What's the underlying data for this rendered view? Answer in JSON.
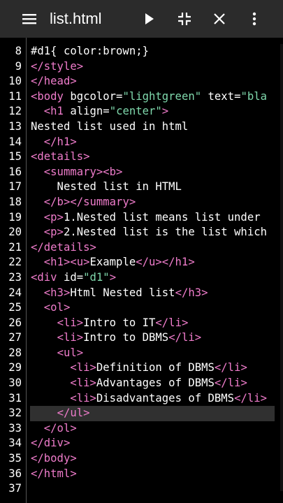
{
  "toolbar": {
    "title": "list.html",
    "icons": [
      "menu-icon",
      "play-icon",
      "collapse-icon",
      "close-icon",
      "more-vert-icon"
    ]
  },
  "colors": {
    "tag": "#ef7ccb",
    "string": "#7fd8ac",
    "text": "#ffffff",
    "background": "#000000",
    "toolbar": "#2b2b2b"
  },
  "editor": {
    "current_line": 32,
    "lines": [
      {
        "n": "8",
        "segs": [
          {
            "c": "a",
            "t": "#d1{ color:brown;}"
          }
        ]
      },
      {
        "n": "9",
        "segs": [
          {
            "c": "t",
            "t": "</style>"
          }
        ]
      },
      {
        "n": "10",
        "segs": [
          {
            "c": "t",
            "t": "</head>"
          }
        ]
      },
      {
        "n": "11",
        "segs": [
          {
            "c": "t",
            "t": "<body "
          },
          {
            "c": "a",
            "t": "bgcolor="
          },
          {
            "c": "s",
            "t": "\"lightgreen\""
          },
          {
            "c": "a",
            "t": " text="
          },
          {
            "c": "s",
            "t": "\"bla"
          }
        ]
      },
      {
        "n": "12",
        "segs": [
          {
            "c": "a",
            "t": "  "
          },
          {
            "c": "t",
            "t": "<h1 "
          },
          {
            "c": "a",
            "t": "align="
          },
          {
            "c": "s",
            "t": "\"center\""
          },
          {
            "c": "t",
            "t": ">"
          }
        ]
      },
      {
        "n": "13",
        "segs": [
          {
            "c": "a",
            "t": "Nested list used in html"
          }
        ]
      },
      {
        "n": "14",
        "segs": [
          {
            "c": "a",
            "t": "  "
          },
          {
            "c": "t",
            "t": "</h1>"
          }
        ]
      },
      {
        "n": "15",
        "segs": [
          {
            "c": "t",
            "t": "<details>"
          }
        ]
      },
      {
        "n": "16",
        "segs": [
          {
            "c": "a",
            "t": "  "
          },
          {
            "c": "t",
            "t": "<summary><b>"
          }
        ]
      },
      {
        "n": "17",
        "segs": [
          {
            "c": "a",
            "t": "    Nested list in HTML"
          }
        ]
      },
      {
        "n": "18",
        "segs": [
          {
            "c": "a",
            "t": "  "
          },
          {
            "c": "t",
            "t": "</b></summary>"
          }
        ]
      },
      {
        "n": "19",
        "segs": [
          {
            "c": "a",
            "t": "  "
          },
          {
            "c": "t",
            "t": "<p>"
          },
          {
            "c": "a",
            "t": "1.Nested list means list under"
          }
        ]
      },
      {
        "n": "20",
        "segs": [
          {
            "c": "a",
            "t": "  "
          },
          {
            "c": "t",
            "t": "<p>"
          },
          {
            "c": "a",
            "t": "2.Nested list is the list which"
          }
        ]
      },
      {
        "n": "21",
        "segs": [
          {
            "c": "t",
            "t": "</details>"
          }
        ]
      },
      {
        "n": "22",
        "segs": [
          {
            "c": "a",
            "t": "  "
          },
          {
            "c": "t",
            "t": "<h1><u>"
          },
          {
            "c": "a",
            "t": "Example"
          },
          {
            "c": "t",
            "t": "</u></h1>"
          }
        ]
      },
      {
        "n": "23",
        "segs": [
          {
            "c": "t",
            "t": "<div "
          },
          {
            "c": "a",
            "t": "id="
          },
          {
            "c": "s",
            "t": "\"d1\""
          },
          {
            "c": "t",
            "t": ">"
          }
        ]
      },
      {
        "n": "24",
        "segs": [
          {
            "c": "a",
            "t": "  "
          },
          {
            "c": "t",
            "t": "<h3>"
          },
          {
            "c": "a",
            "t": "Html Nested list"
          },
          {
            "c": "t",
            "t": "</h3>"
          }
        ]
      },
      {
        "n": "25",
        "segs": [
          {
            "c": "a",
            "t": "  "
          },
          {
            "c": "t",
            "t": "<ol>"
          }
        ]
      },
      {
        "n": "26",
        "segs": [
          {
            "c": "a",
            "t": "    "
          },
          {
            "c": "t",
            "t": "<li>"
          },
          {
            "c": "a",
            "t": "Intro to IT"
          },
          {
            "c": "t",
            "t": "</li>"
          }
        ]
      },
      {
        "n": "27",
        "segs": [
          {
            "c": "a",
            "t": "    "
          },
          {
            "c": "t",
            "t": "<li>"
          },
          {
            "c": "a",
            "t": "Intro to DBMS"
          },
          {
            "c": "t",
            "t": "</li>"
          }
        ]
      },
      {
        "n": "28",
        "segs": [
          {
            "c": "a",
            "t": "    "
          },
          {
            "c": "t",
            "t": "<ul>"
          }
        ]
      },
      {
        "n": "29",
        "segs": [
          {
            "c": "a",
            "t": "      "
          },
          {
            "c": "t",
            "t": "<li>"
          },
          {
            "c": "a",
            "t": "Definition of DBMS"
          },
          {
            "c": "t",
            "t": "</li>"
          }
        ]
      },
      {
        "n": "30",
        "segs": [
          {
            "c": "a",
            "t": "      "
          },
          {
            "c": "t",
            "t": "<li>"
          },
          {
            "c": "a",
            "t": "Advantages of DBMS"
          },
          {
            "c": "t",
            "t": "</li>"
          }
        ]
      },
      {
        "n": "31",
        "segs": [
          {
            "c": "a",
            "t": "      "
          },
          {
            "c": "t",
            "t": "<li>"
          },
          {
            "c": "a",
            "t": "Disadvantages of DBMS"
          },
          {
            "c": "t",
            "t": "</li>"
          }
        ]
      },
      {
        "n": "32",
        "segs": [
          {
            "c": "a",
            "t": "    "
          },
          {
            "c": "t",
            "t": "</ul>"
          }
        ]
      },
      {
        "n": "33",
        "segs": [
          {
            "c": "a",
            "t": "  "
          },
          {
            "c": "t",
            "t": "</ol>"
          }
        ]
      },
      {
        "n": "34",
        "segs": [
          {
            "c": "t",
            "t": "</div>"
          }
        ]
      },
      {
        "n": "35",
        "segs": [
          {
            "c": "t",
            "t": "</body>"
          }
        ]
      },
      {
        "n": "36",
        "segs": [
          {
            "c": "t",
            "t": "</html>"
          }
        ]
      },
      {
        "n": "37",
        "segs": []
      }
    ]
  }
}
